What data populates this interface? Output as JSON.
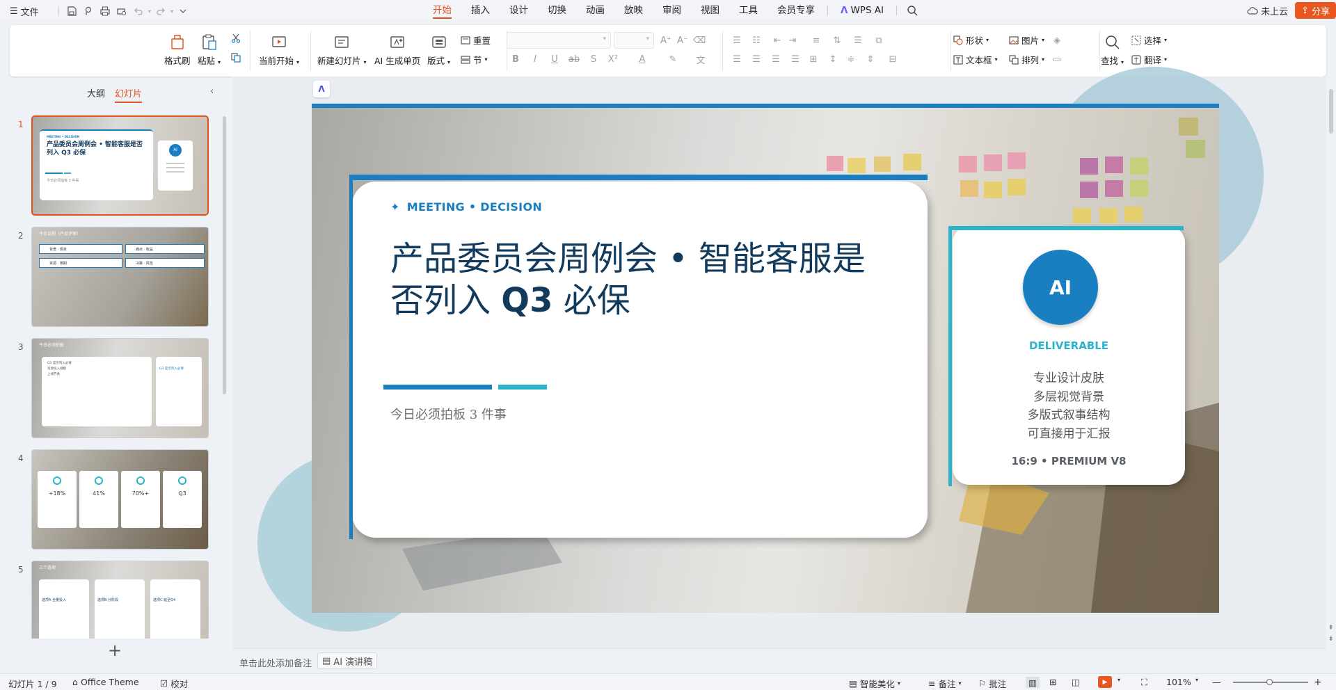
{
  "topbar": {
    "menu_label": "文件",
    "tabs": [
      "开始",
      "插入",
      "设计",
      "切换",
      "动画",
      "放映",
      "审阅",
      "视图",
      "工具",
      "会员专享",
      "WPS AI"
    ],
    "cloud_label": "未上云",
    "share_label": "分享"
  },
  "ribbon": {
    "format_painter": "格式刷",
    "paste": "粘贴",
    "slideshow": "当前开始",
    "new_slide": "新建幻灯片",
    "ai_page": "AI 生成单页",
    "layout": "版式",
    "reset": "重置",
    "section": "节",
    "shape": "形状",
    "picture": "图片",
    "textbox": "文本框",
    "arrange": "排列",
    "find": "查找",
    "select": "选择",
    "translate": "翻译"
  },
  "leftpane": {
    "tab_outline": "大纲",
    "tab_slides": "幻灯片",
    "slide_numbers": [
      "1",
      "2",
      "3",
      "4",
      "5"
    ],
    "t1": {
      "kicker": "MEETING • DECISION",
      "title": "产品委员会周例会 • 智能客服是否列入 Q3 必保",
      "sub": "今日必须拍板 3 件事",
      "ai": "AI"
    },
    "t2": {
      "header": "今日议程（产品评审）",
      "items": [
        "背景 · 现状",
        "痛点 · 收益",
        "资源 · 排期",
        "决策 · 风险"
      ]
    },
    "t3": {
      "header": "今日必须拍板",
      "bullets": [
        "Q3 是否列入必保",
        "资源投入规模",
        "上线节奏"
      ],
      "side": "Q3 是否列入必保"
    },
    "t4": {
      "stats": [
        "+18%",
        "41%",
        "70%+",
        "Q3"
      ]
    },
    "t5": {
      "header": "三个选项",
      "cards": [
        "选项A 全量投入",
        "选项B 分阶段",
        "选项C 延至Q4"
      ]
    }
  },
  "slide": {
    "kicker": "MEETING • DECISION",
    "title_l1": "产品委员会周例会 • 智能客服是",
    "title_l2": "否列入 ",
    "title_q3": "Q3",
    "title_l2b": " 必保",
    "subtitle": "今日必须拍板 3 件事",
    "ai_badge": "AI",
    "deliverable": "DELIVERABLE",
    "features": [
      "专业设计皮肤",
      "多层视觉背景",
      "多版式叙事结构",
      "可直接用于汇报"
    ],
    "footer": "16:9 • PREMIUM V8"
  },
  "notes": {
    "placeholder": "单击此处添加备注",
    "ai_button": "AI 演讲稿"
  },
  "status": {
    "slide_count": "幻灯片 1 / 9",
    "theme": "Office Theme",
    "proof": "校对",
    "beautify": "智能美化",
    "notes": "备注",
    "comments": "批注",
    "zoom": "101%"
  },
  "colors": {
    "accent": "#e2511c",
    "brand_blue": "#1a7fc1",
    "teal": "#2bb3c9",
    "navy": "#123a5c"
  }
}
